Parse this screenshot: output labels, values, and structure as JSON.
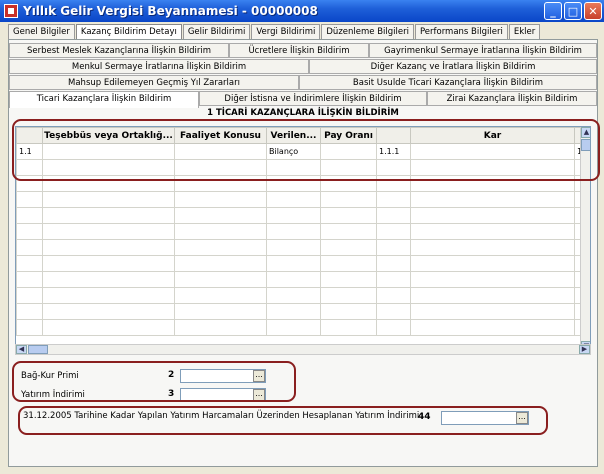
{
  "window": {
    "title": "Yıllık Gelir Vergisi Beyannamesi - 00000008",
    "min_glyph": "_",
    "max_glyph": "□",
    "close_glyph": "✕"
  },
  "top_tabs": [
    {
      "label": "Genel Bilgiler"
    },
    {
      "label": "Kazanç Bildirim Detayı"
    },
    {
      "label": "Gelir Bildirimi"
    },
    {
      "label": "Vergi Bildirimi"
    },
    {
      "label": "Düzenleme Bilgileri"
    },
    {
      "label": "Performans Bilgileri"
    },
    {
      "label": "Ekler"
    }
  ],
  "sub_tabs": {
    "row1": [
      "Serbest Meslek Kazançlarına İlişkin Bildirim",
      "Ücretlere İlişkin Bildirim",
      "Gayrimenkul Sermaye İratlarına İlişkin Bildirim"
    ],
    "row2": [
      "Menkul Sermaye İratlarına İlişkin Bildirim",
      "Diğer Kazanç ve İratlara İlişkin Bildirim"
    ],
    "row3": [
      "Mahsup Edilemeyen Geçmiş Yıl Zararları",
      "Basit Usulde Ticari Kazançlara İlişkin Bildirim"
    ],
    "row4": [
      "Ticari Kazançlara İlişkin Bildirim",
      "Diğer İstisna ve İndirimlere İlişkin Bildirim",
      "Zirai Kazançlara İlişkin Bildirim"
    ]
  },
  "section_title": "1 TİCARİ KAZANÇLARA İLİŞKİN BİLDİRİM",
  "grid": {
    "columns": [
      "",
      "Teşebbüs veya Ortaklığ...",
      "Faaliyet Konusu",
      "Verilen...",
      "Pay Oranı",
      "",
      "Kar",
      ""
    ],
    "rows": [
      [
        "1.1",
        "",
        "",
        "Bilanço",
        "",
        "1.1.1",
        "",
        "1"
      ]
    ],
    "scroll_up": "▲",
    "scroll_down": "▼",
    "scroll_left": "◀",
    "scroll_right": "▶"
  },
  "form": {
    "bagkur_label": "Bağ-Kur Primi",
    "bagkur_num": "2",
    "bagkur_value": "",
    "yatirim_label": "Yatırım İndirimi",
    "yatirim_num": "3",
    "yatirim_value": "",
    "harcama_label": "31.12.2005 Tarihine Kadar Yapılan Yatırım Harcamaları Üzerinden Hesaplanan Yatırım İndirimi",
    "harcama_num": "44",
    "harcama_value": "",
    "ellipsis": "..."
  }
}
